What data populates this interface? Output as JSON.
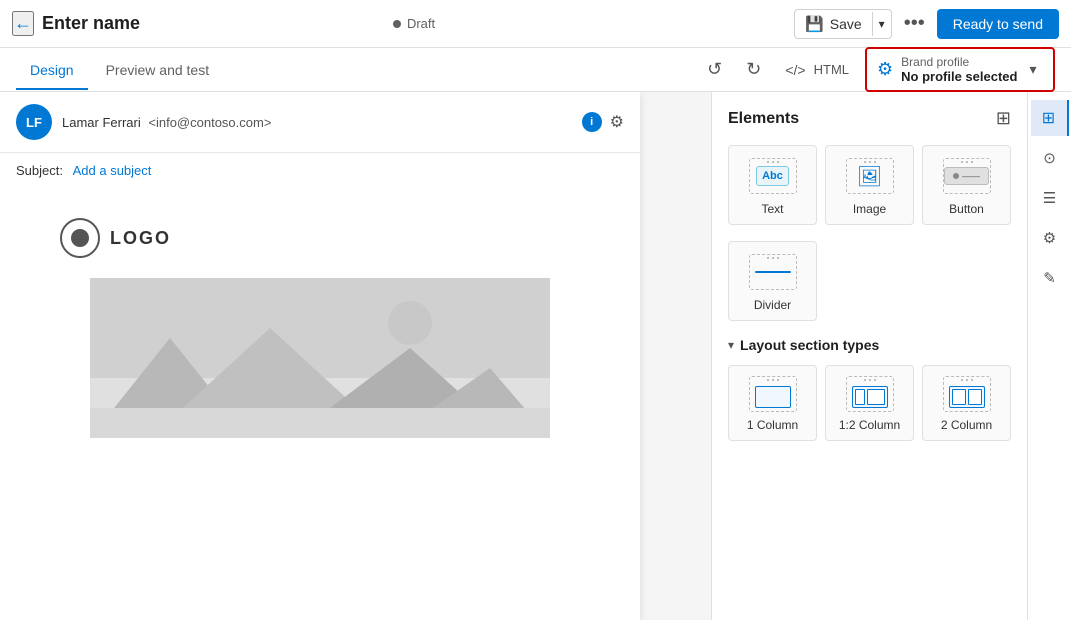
{
  "topbar": {
    "back_label": "←",
    "title": "Enter name",
    "draft_label": "Draft",
    "save_label": "Save",
    "more_label": "•••",
    "ready_label": "Ready to send"
  },
  "tabs": {
    "design_label": "Design",
    "preview_label": "Preview and test"
  },
  "toolbar": {
    "undo_label": "↺",
    "redo_label": "↻",
    "html_label": "</> HTML"
  },
  "brand_profile": {
    "label": "Brand profile",
    "value": "No profile selected"
  },
  "email": {
    "avatar_initials": "LF",
    "from_name": "Lamar Ferrari",
    "from_email": "<info@contoso.com>",
    "subject_label": "Subject:",
    "subject_value": "Add a subject",
    "logo_text": "LOGO"
  },
  "elements_panel": {
    "title": "Elements",
    "items": [
      {
        "label": "Text",
        "icon": "text-icon"
      },
      {
        "label": "Image",
        "icon": "image-icon"
      },
      {
        "label": "Button",
        "icon": "button-icon"
      }
    ],
    "row2": [
      {
        "label": "Divider",
        "icon": "divider-icon"
      }
    ],
    "layout_section_label": "Layout section types",
    "layouts": [
      {
        "label": "1 Column",
        "type": "col1"
      },
      {
        "label": "1:2 Column",
        "type": "col12"
      },
      {
        "label": "2 Column",
        "type": "col2"
      }
    ]
  },
  "icon_sidebar": {
    "icons": [
      {
        "name": "layout-icon",
        "label": "⊞",
        "active": true
      },
      {
        "name": "people-icon",
        "label": "⊕"
      },
      {
        "name": "list-icon",
        "label": "☰"
      },
      {
        "name": "person-settings-icon",
        "label": "⚙"
      },
      {
        "name": "brush-icon",
        "label": "✎"
      }
    ]
  }
}
